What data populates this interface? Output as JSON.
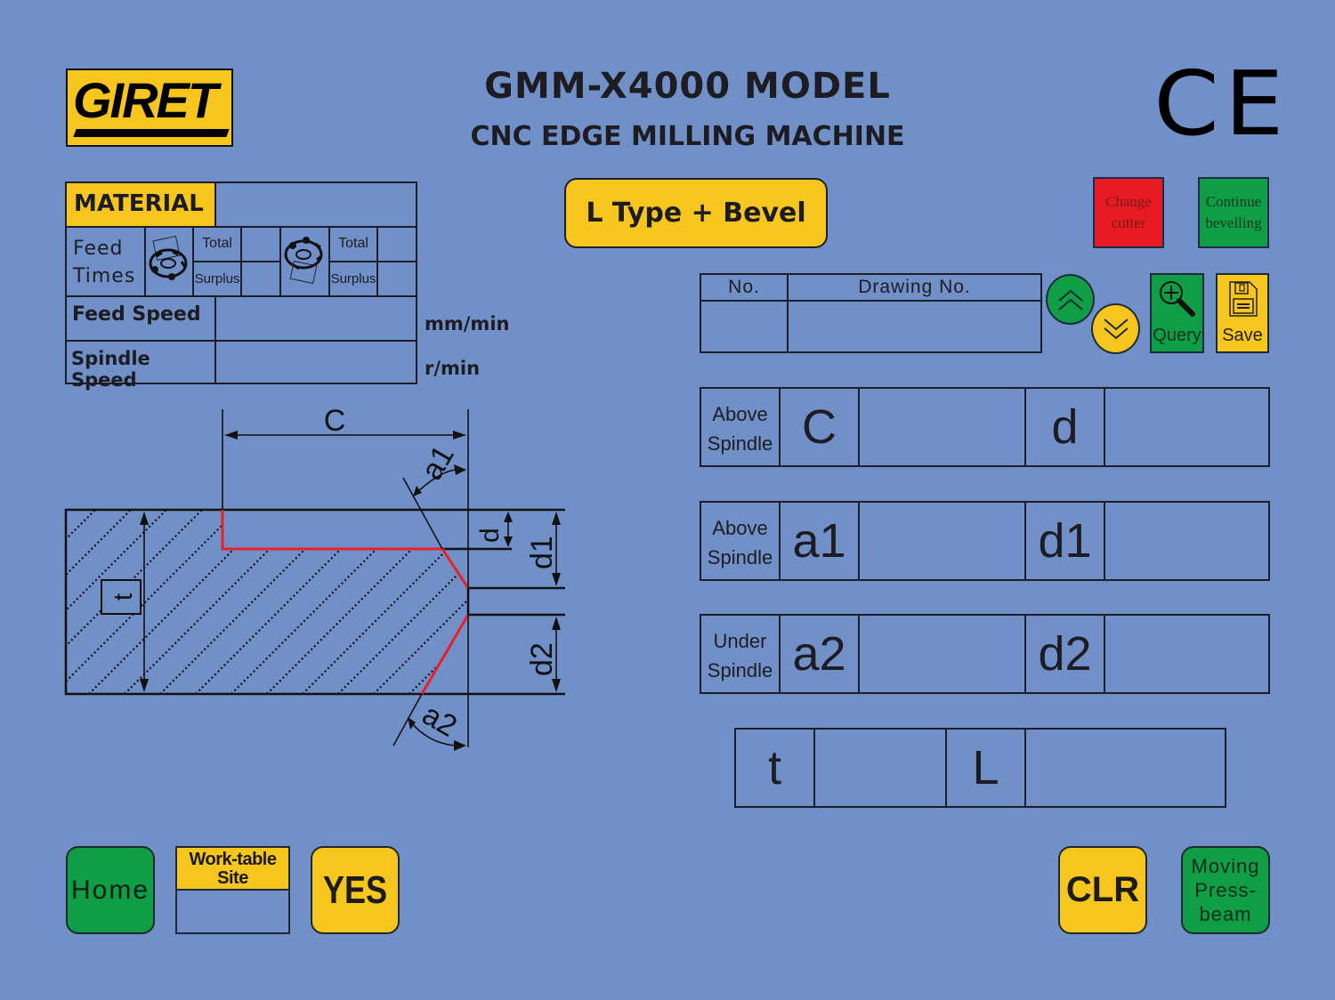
{
  "header": {
    "logo_text": "GIRET",
    "title": "GMM-X4000 MODEL",
    "subtitle": "CNC EDGE MILLING MACHINE",
    "certification_mark": "CE"
  },
  "material_table": {
    "material_label": "MATERIAL",
    "material_value": "",
    "feed_times_label": [
      "Feed",
      "Times"
    ],
    "cutter_groups": [
      {
        "total_label": "Total",
        "surplus_label": "Surplus",
        "total_value": "",
        "surplus_value": ""
      },
      {
        "total_label": "Total",
        "surplus_label": "Surplus",
        "total_value": "",
        "surplus_value": ""
      }
    ],
    "feed_speed_label": "Feed Speed",
    "feed_speed_value": "",
    "feed_speed_unit": "mm/min",
    "spindle_speed_label": "Spindle Speed",
    "spindle_speed_value": "",
    "spindle_speed_unit": "r/min"
  },
  "mode_button": "L Type + Bevel",
  "actions": {
    "change_cutter": [
      "Change",
      "cutter"
    ],
    "continue_bevelling": [
      "Continue",
      "bevelling"
    ],
    "query": "Query",
    "save": "Save",
    "home": "Home",
    "yes": "YES",
    "clr": "CLR",
    "moving_press_beam": [
      "Moving",
      "Press-",
      "beam"
    ]
  },
  "drawing_table": {
    "col_no": "No.",
    "col_drawing_no": "Drawing No.",
    "no_value": "",
    "drawing_no_value": ""
  },
  "colors": {
    "background": "#7190c8",
    "yellow": "#f6c51e",
    "green": "#0f9d46",
    "red": "#e81a24",
    "profile_red": "#e8202a"
  },
  "params": [
    {
      "side": [
        "Above",
        "Spindle"
      ],
      "sym1": "C",
      "val1": "",
      "sym2": "d",
      "val2": ""
    },
    {
      "side": [
        "Above",
        "Spindle"
      ],
      "sym1": "a1",
      "val1": "",
      "sym2": "d1",
      "val2": ""
    },
    {
      "side": [
        "Under",
        "Spindle"
      ],
      "sym1": "a2",
      "val1": "",
      "sym2": "d2",
      "val2": ""
    }
  ],
  "tl_row": {
    "sym1": "t",
    "val1": "",
    "sym2": "L",
    "val2": ""
  },
  "worktable": {
    "label": [
      "Work-table",
      "Site"
    ],
    "value": ""
  },
  "diagram": {
    "labels": {
      "C": "C",
      "a1": "a1",
      "a2": "a2",
      "d": "d",
      "d1": "d1",
      "d2": "d2",
      "t": "t"
    }
  }
}
